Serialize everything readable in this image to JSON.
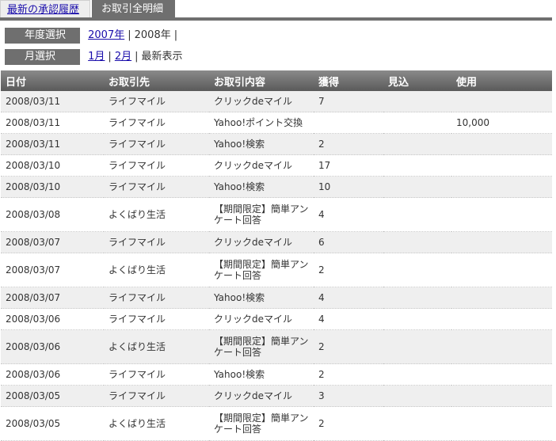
{
  "tabs": {
    "history_label": "最新の承認履歴",
    "detail_label": "お取引全明細"
  },
  "year_filter": {
    "label": "年度選択",
    "link_2007": "2007年",
    "current": "2008年"
  },
  "month_filter": {
    "label": "月選択",
    "link_jan": "1月",
    "link_feb": "2月",
    "current": "最新表示"
  },
  "table": {
    "headers": {
      "date": "日付",
      "partner": "お取引先",
      "content": "お取引内容",
      "earned": "獲得",
      "pending": "見込",
      "used": "使用"
    },
    "rows": [
      {
        "date": "2008/03/11",
        "partner": "ライフマイル",
        "content": "クリックdeマイル",
        "earned": "7",
        "pending": "",
        "used": ""
      },
      {
        "date": "2008/03/11",
        "partner": "ライフマイル",
        "content": "Yahoo!ポイント交換",
        "earned": "",
        "pending": "",
        "used": "10,000"
      },
      {
        "date": "2008/03/11",
        "partner": "ライフマイル",
        "content": "Yahoo!検索",
        "earned": "2",
        "pending": "",
        "used": ""
      },
      {
        "date": "2008/03/10",
        "partner": "ライフマイル",
        "content": "クリックdeマイル",
        "earned": "17",
        "pending": "",
        "used": ""
      },
      {
        "date": "2008/03/10",
        "partner": "ライフマイル",
        "content": "Yahoo!検索",
        "earned": "10",
        "pending": "",
        "used": ""
      },
      {
        "date": "2008/03/08",
        "partner": "よくばり生活",
        "content": "【期間限定】簡単アンケート回答",
        "earned": "4",
        "pending": "",
        "used": ""
      },
      {
        "date": "2008/03/07",
        "partner": "ライフマイル",
        "content": "クリックdeマイル",
        "earned": "6",
        "pending": "",
        "used": ""
      },
      {
        "date": "2008/03/07",
        "partner": "よくばり生活",
        "content": "【期間限定】簡単アンケート回答",
        "earned": "2",
        "pending": "",
        "used": ""
      },
      {
        "date": "2008/03/07",
        "partner": "ライフマイル",
        "content": "Yahoo!検索",
        "earned": "4",
        "pending": "",
        "used": ""
      },
      {
        "date": "2008/03/06",
        "partner": "ライフマイル",
        "content": "クリックdeマイル",
        "earned": "4",
        "pending": "",
        "used": ""
      },
      {
        "date": "2008/03/06",
        "partner": "よくばり生活",
        "content": "【期間限定】簡単アンケート回答",
        "earned": "2",
        "pending": "",
        "used": ""
      },
      {
        "date": "2008/03/06",
        "partner": "ライフマイル",
        "content": "Yahoo!検索",
        "earned": "2",
        "pending": "",
        "used": ""
      },
      {
        "date": "2008/03/05",
        "partner": "ライフマイル",
        "content": "クリックdeマイル",
        "earned": "3",
        "pending": "",
        "used": ""
      },
      {
        "date": "2008/03/05",
        "partner": "よくばり生活",
        "content": "【期間限定】簡単アンケート回答",
        "earned": "2",
        "pending": "",
        "used": ""
      }
    ]
  }
}
